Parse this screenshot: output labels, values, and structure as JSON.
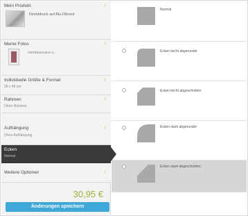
{
  "sidebar": {
    "items": [
      {
        "title": "Mein Produkt",
        "detail": "Direktdruck auf Alu-Dibond"
      },
      {
        "title": "Meine Fotos",
        "detail": "20076831ecdem-1..."
      },
      {
        "title": "Individuelle Größe & Format",
        "subtitle": "30 x 45 cm"
      },
      {
        "title": "Rahmen",
        "subtitle": "Ohne Rahmen"
      },
      {
        "title": "Aufhängung",
        "subtitle": "Ohne Aufhängung"
      },
      {
        "title": "Ecken",
        "subtitle": "Normal"
      },
      {
        "title": "Weitere Optionen",
        "subtitle": ""
      }
    ],
    "active_index": 5,
    "price": "30,95 €",
    "save_label": "Änderungen speichern"
  },
  "options": {
    "items": [
      {
        "label": "Normal",
        "shape": "normal",
        "selected": false
      },
      {
        "label": "Ecken leicht abgerundet",
        "shape": "round-light",
        "selected": false
      },
      {
        "label": "Ecken leicht abgeschnitten",
        "shape": "cut-light",
        "selected": false
      },
      {
        "label": "Ecken stark abgerundet",
        "shape": "round-strong",
        "selected": false
      },
      {
        "label": "Ecken stark abgeschnitten",
        "shape": "cut-strong",
        "selected": true
      }
    ]
  },
  "colors": {
    "accent_green": "#95b636",
    "chevron_green": "#b3d255",
    "button_blue": "#3fa8d8",
    "active_dark": "#3a3a3a",
    "selected_row": "#d6d6d6",
    "shape_gray": "#a9a9a9"
  },
  "icons": {
    "chevron": "chevron-right-icon",
    "radio": "radio-icon"
  }
}
